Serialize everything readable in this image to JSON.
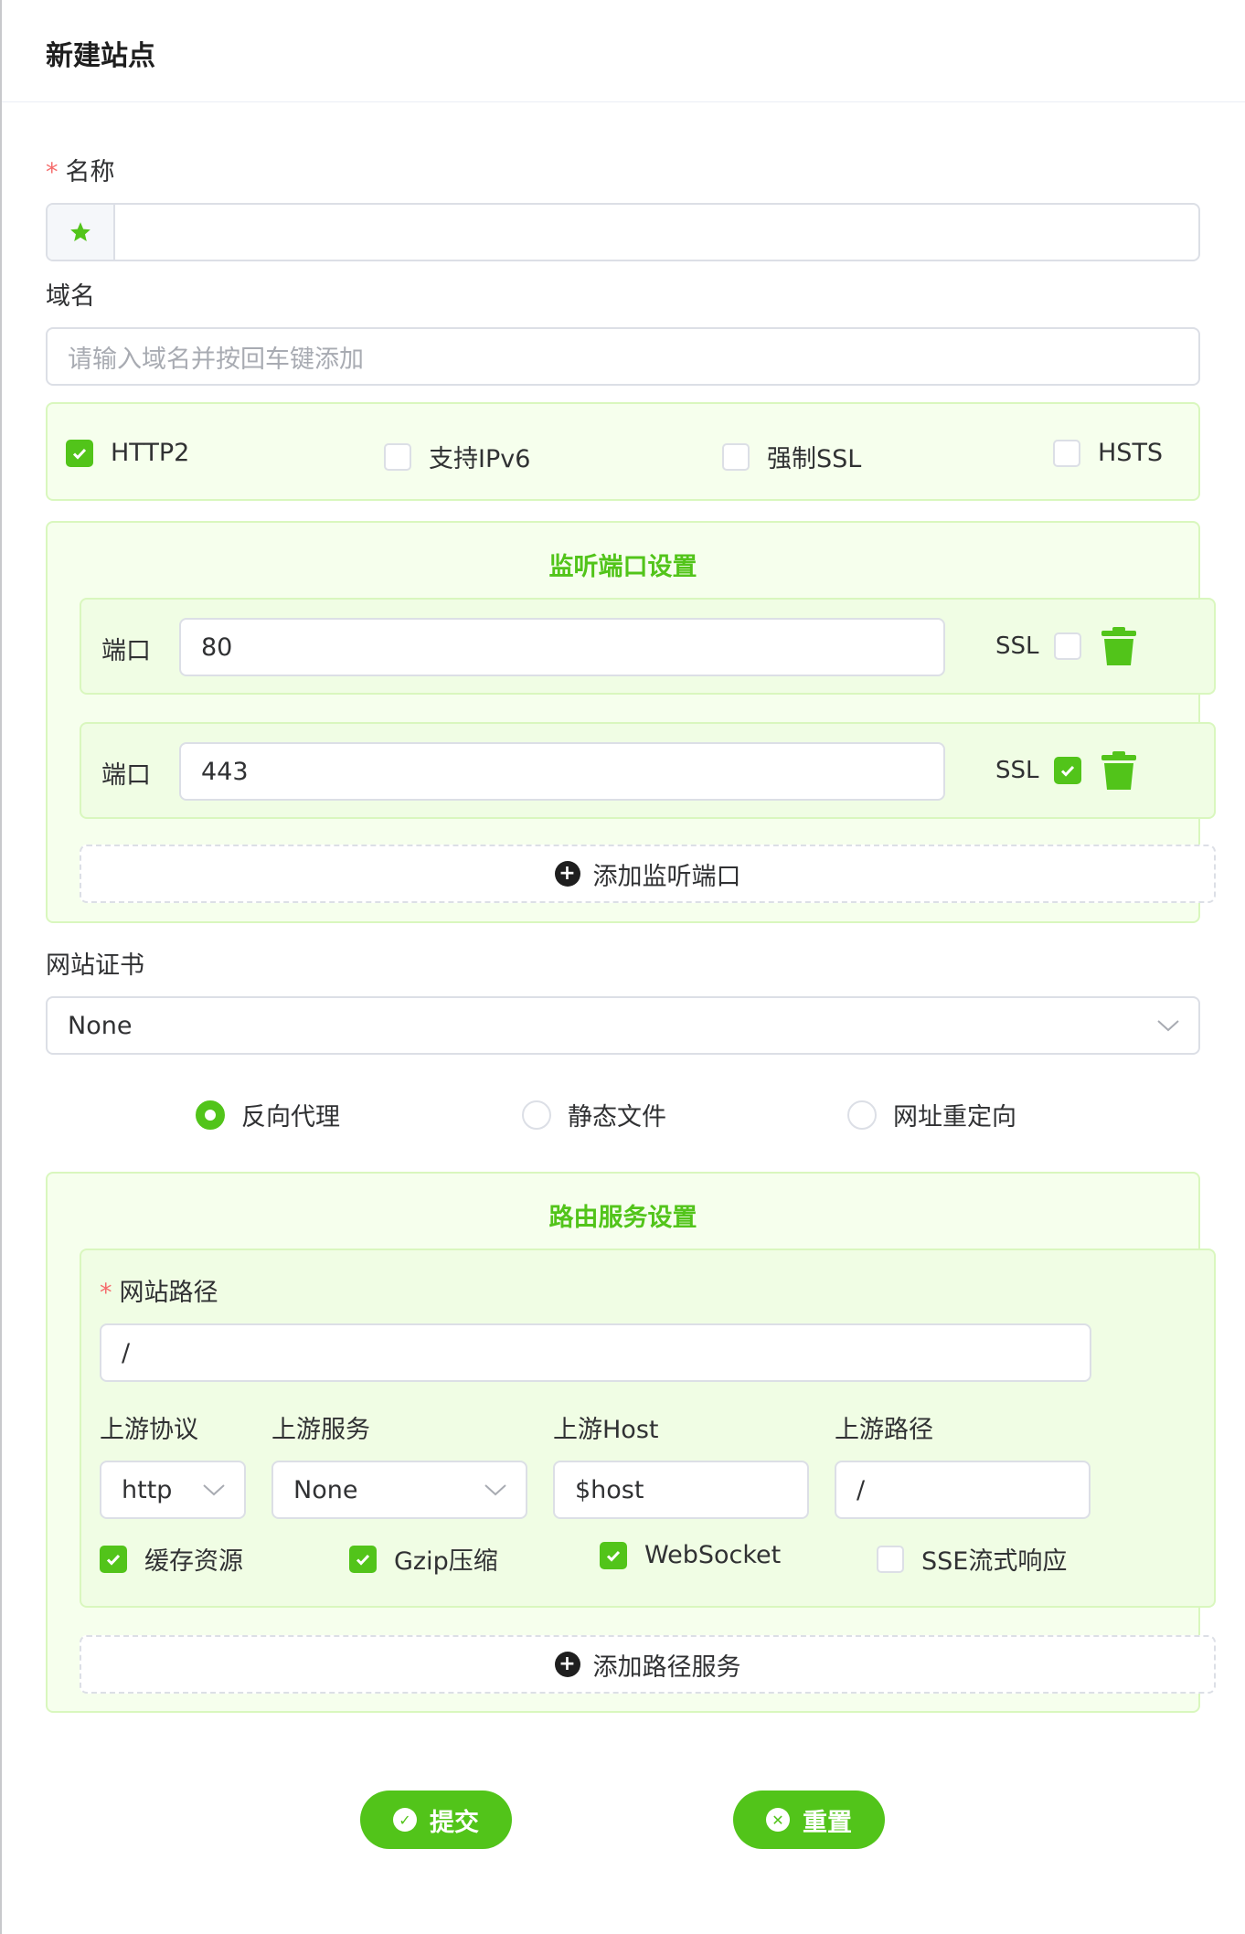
{
  "header": {
    "title": "新建站点"
  },
  "name_field": {
    "label": "名称",
    "required_mark": "*",
    "value": ""
  },
  "domain_field": {
    "label": "域名",
    "placeholder": "请输入域名并按回车键添加"
  },
  "options": [
    {
      "label": "HTTP2",
      "checked": true
    },
    {
      "label": "支持IPv6",
      "checked": false
    },
    {
      "label": "强制SSL",
      "checked": false
    },
    {
      "label": "HSTS",
      "checked": false
    }
  ],
  "listen": {
    "title": "监听端口设置",
    "ports": [
      {
        "label": "端口",
        "value": "80",
        "ssl_label": "SSL",
        "ssl": false
      },
      {
        "label": "端口",
        "value": "443",
        "ssl_label": "SSL",
        "ssl": true
      }
    ],
    "add_label": "添加监听端口"
  },
  "certificate": {
    "label": "网站证书",
    "value": "None"
  },
  "site_type": [
    {
      "label": "反向代理",
      "selected": true
    },
    {
      "label": "静态文件",
      "selected": false
    },
    {
      "label": "网址重定向",
      "selected": false
    }
  ],
  "route": {
    "title": "路由服务设置",
    "path_label": "网站路径",
    "required_mark": "*",
    "path_value": "/",
    "protocol_label": "上游协议",
    "protocol_value": "http",
    "service_label": "上游服务",
    "service_value": "None",
    "host_label": "上游Host",
    "host_value": "$host",
    "upstream_path_label": "上游路径",
    "upstream_path_value": "/",
    "flags": [
      {
        "label": "缓存资源",
        "checked": true
      },
      {
        "label": "Gzip压缩",
        "checked": true
      },
      {
        "label": "WebSocket",
        "checked": true
      },
      {
        "label": "SSE流式响应",
        "checked": false
      }
    ],
    "add_label": "添加路径服务"
  },
  "actions": {
    "submit": "提交",
    "reset": "重置"
  },
  "colors": {
    "accent": "#52c41a",
    "panel_bg": "#f6ffed",
    "panel_border": "#d9f7be",
    "required": "#f56c6c"
  }
}
